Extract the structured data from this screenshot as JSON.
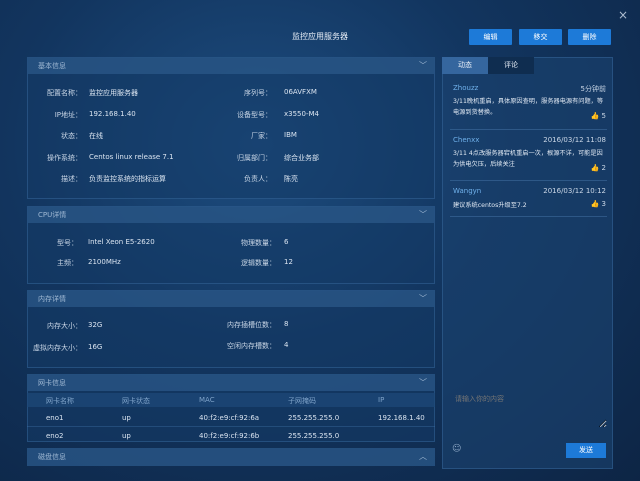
{
  "header": {
    "title": "监控应用服务器",
    "close_symbol": "×",
    "buttons": [
      "编辑",
      "移交",
      "删除"
    ]
  },
  "basic": {
    "title": "基本信息",
    "fields": [
      {
        "label": "配置名称：",
        "value": "监控应用服务器"
      },
      {
        "label": "序列号：",
        "value": "06AVFXM"
      },
      {
        "label": "IP地址：",
        "value": "192.168.1.40"
      },
      {
        "label": "设备型号：",
        "value": "x3550-M4"
      },
      {
        "label": "状态：",
        "value": "在线"
      },
      {
        "label": "厂家：",
        "value": "IBM"
      },
      {
        "label": "操作系统：",
        "value": "Centos linux release 7.1"
      },
      {
        "label": "归属部门：",
        "value": "综合业务部"
      },
      {
        "label": "描述：",
        "value": "负责监控系统的指标运算"
      },
      {
        "label": "负责人：",
        "value": "陈亮"
      }
    ]
  },
  "cpu": {
    "title": "CPU详情",
    "fields": [
      {
        "label": "型号：",
        "value": "Intel Xeon E5-2620"
      },
      {
        "label": "物理数量：",
        "value": "6"
      },
      {
        "label": "主频：",
        "value": "2100MHz"
      },
      {
        "label": "逻辑数量：",
        "value": "12"
      }
    ]
  },
  "memory": {
    "title": "内存详情",
    "fields": [
      {
        "label": "内存大小：",
        "value": "32G"
      },
      {
        "label": "内存插槽位数：",
        "value": "8"
      },
      {
        "label": "虚拟内存大小：",
        "value": "16G"
      },
      {
        "label": "空闲内存槽数：",
        "value": "4"
      }
    ]
  },
  "nic": {
    "title": "网卡信息",
    "columns": [
      "网卡名称",
      "网卡状态",
      "MAC",
      "子网掩码",
      "IP"
    ],
    "rows": [
      [
        "eno1",
        "up",
        "40:f2:e9:cf:92:6a",
        "255.255.255.0",
        "192.168.1.40"
      ],
      [
        "eno2",
        "up",
        "40:f2:e9:cf:92:6b",
        "255.255.255.0",
        ""
      ]
    ]
  },
  "disk": {
    "title": "磁盘信息"
  },
  "icons": {
    "chevron_down": "﹀",
    "chevron_up": "︿",
    "thumb": "👍",
    "emoji": "☺"
  },
  "sidebar": {
    "tabs": [
      "动态",
      "评论"
    ],
    "active_tab": "动态",
    "comments": [
      {
        "user": "Zhouzz",
        "time": "5分钟前",
        "text": "3/11晚机重启，具体原因查明，服务器电源有问题，等电源到货替换。",
        "likes": "5",
        "liked": true
      },
      {
        "user": "Chenxx",
        "time": "2016/03/12   11:08",
        "text": "3/11 4点改服务器宕机重启一次，根源不详，可能是因为供电欠压，后续关注",
        "likes": "2",
        "liked": false
      },
      {
        "user": "Wangyn",
        "time": "2016/03/12   10:12",
        "text": "建议系统centos升级至7.2",
        "likes": "3",
        "liked": false
      }
    ],
    "input_placeholder": "请输入你的内容",
    "send_label": "发送"
  },
  "colors": {
    "accent": "#1d7ad8",
    "username": "#6fb0ea",
    "liked_thumb": "#f1b93a"
  }
}
